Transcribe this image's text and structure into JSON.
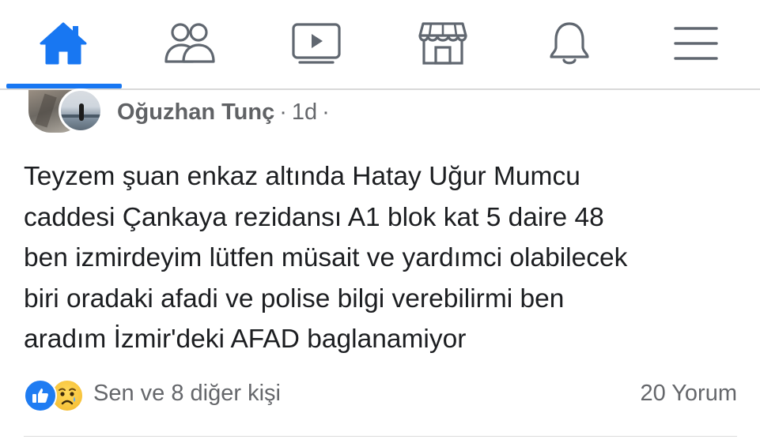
{
  "nav": {
    "items": [
      {
        "name": "home",
        "icon": "home-icon",
        "active": true
      },
      {
        "name": "friends",
        "icon": "friends-icon",
        "active": false
      },
      {
        "name": "watch",
        "icon": "video-icon",
        "active": false
      },
      {
        "name": "marketplace",
        "icon": "store-icon",
        "active": false
      },
      {
        "name": "notifications",
        "icon": "bell-icon",
        "active": false
      },
      {
        "name": "menu",
        "icon": "hamburger-icon",
        "active": false
      }
    ],
    "active_color": "#1877f2",
    "icon_color": "#606770"
  },
  "post": {
    "author": "Oğuzhan Tunç",
    "separator": "·",
    "time": "1d",
    "trailing_separator": "·",
    "body_lines": [
      "Teyzem şuan enkaz altında Hatay Uğur Mumcu",
      "caddesi Çankaya rezidansı A1 blok kat 5 daire 48",
      "ben izmirdeyim lütfen müsait ve yardımci olabilecek",
      "biri oradaki afadi ve polise bilgi verebilirmi ben",
      "aradım İzmir'deki AFAD baglanamiyor"
    ],
    "reactions": {
      "icons": [
        "like-icon",
        "sad-face-icon"
      ],
      "text": "Sen ve 8 diğer kişi"
    },
    "comments": "20 Yorum"
  }
}
